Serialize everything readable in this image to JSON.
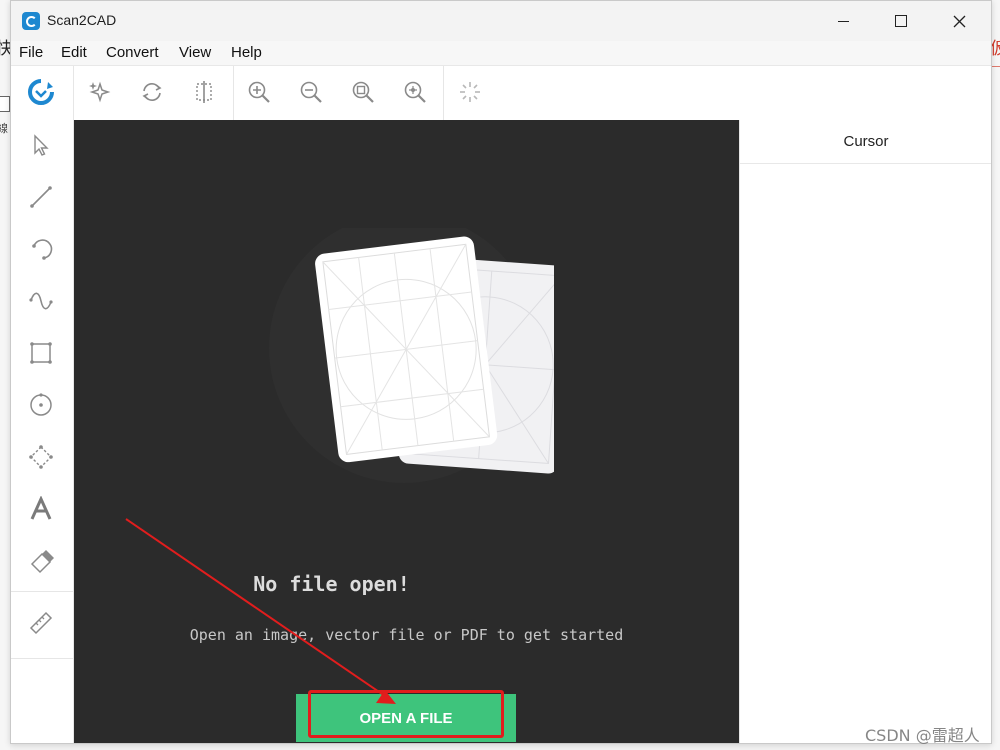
{
  "window": {
    "title": "Scan2CAD",
    "controls": [
      "minimize",
      "maximize",
      "close"
    ]
  },
  "menu": [
    "File",
    "Edit",
    "Convert",
    "View",
    "Help"
  ],
  "toolbar": {
    "items": [
      {
        "icon": "scan2cad-logo-icon"
      },
      {
        "icon": "sparkle-icon"
      },
      {
        "icon": "refresh-icon"
      },
      {
        "icon": "crop-icon"
      },
      {
        "icon": "zoom-in-icon"
      },
      {
        "icon": "zoom-out-icon"
      },
      {
        "icon": "zoom-fit-icon"
      },
      {
        "icon": "zoom-custom-icon"
      },
      {
        "icon": "loading-icon"
      }
    ]
  },
  "left_tools": [
    {
      "icon": "select-arrow-icon"
    },
    {
      "icon": "line-tool-icon"
    },
    {
      "icon": "arc-tool-icon"
    },
    {
      "icon": "curve-tool-icon"
    },
    {
      "icon": "rectangle-tool-icon"
    },
    {
      "icon": "circle-tool-icon"
    },
    {
      "icon": "polygon-tool-icon"
    },
    {
      "icon": "text-tool-icon"
    },
    {
      "icon": "eraser-tool-icon"
    },
    {
      "icon": "ruler-tool-icon"
    }
  ],
  "right_panel": {
    "title": "Cursor"
  },
  "empty_state": {
    "title": "No file open!",
    "subtitle": "Open an image, vector file or PDF to get started",
    "button": "OPEN A FILE"
  },
  "background": {
    "left_char_top": "快",
    "left_char_bottom": "線",
    "right_char": "仮"
  },
  "watermark": "CSDN @雷超人",
  "colors": {
    "canvas_bg": "#2b2b2b",
    "button_green": "#3ec47c",
    "annotation_red": "#e11d1d",
    "brand_blue": "#1e88d0"
  }
}
